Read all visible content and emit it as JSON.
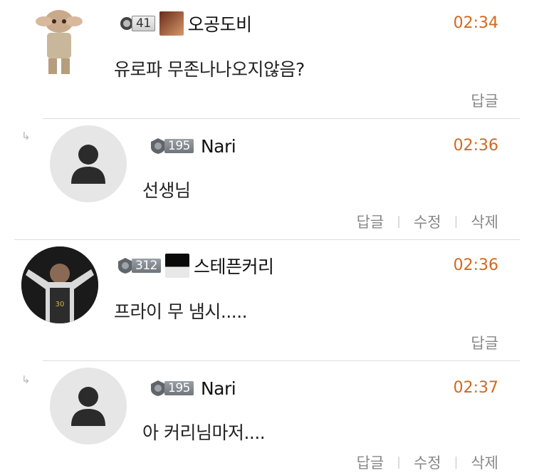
{
  "comments": [
    {
      "type": "top",
      "avatar": "figure-avatar",
      "level": "41",
      "nickname": "오공도비",
      "time": "02:34",
      "text": "유로파 무존나나오지않음?",
      "actions": [
        "답글"
      ]
    },
    {
      "type": "reply",
      "avatar": "person-icon",
      "level": "195",
      "nickname": "Nari",
      "time": "02:36",
      "text": "선생님",
      "actions": [
        "답글",
        "수정",
        "삭제"
      ]
    },
    {
      "type": "top",
      "avatar": "player-photo-avatar",
      "level": "312",
      "nickname": "스테픈커리",
      "time": "02:36",
      "text": "프라이 무 냄시.....",
      "actions": [
        "답글"
      ]
    },
    {
      "type": "reply",
      "avatar": "person-icon",
      "level": "195",
      "nickname": "Nari",
      "time": "02:37",
      "text": "아 커리님마저....",
      "actions": [
        "답글",
        "수정",
        "삭제"
      ]
    }
  ],
  "reply_arrow_glyph": "↳",
  "colors": {
    "time": "#d2691e",
    "action": "#888888",
    "divider": "#dcdcdc"
  }
}
